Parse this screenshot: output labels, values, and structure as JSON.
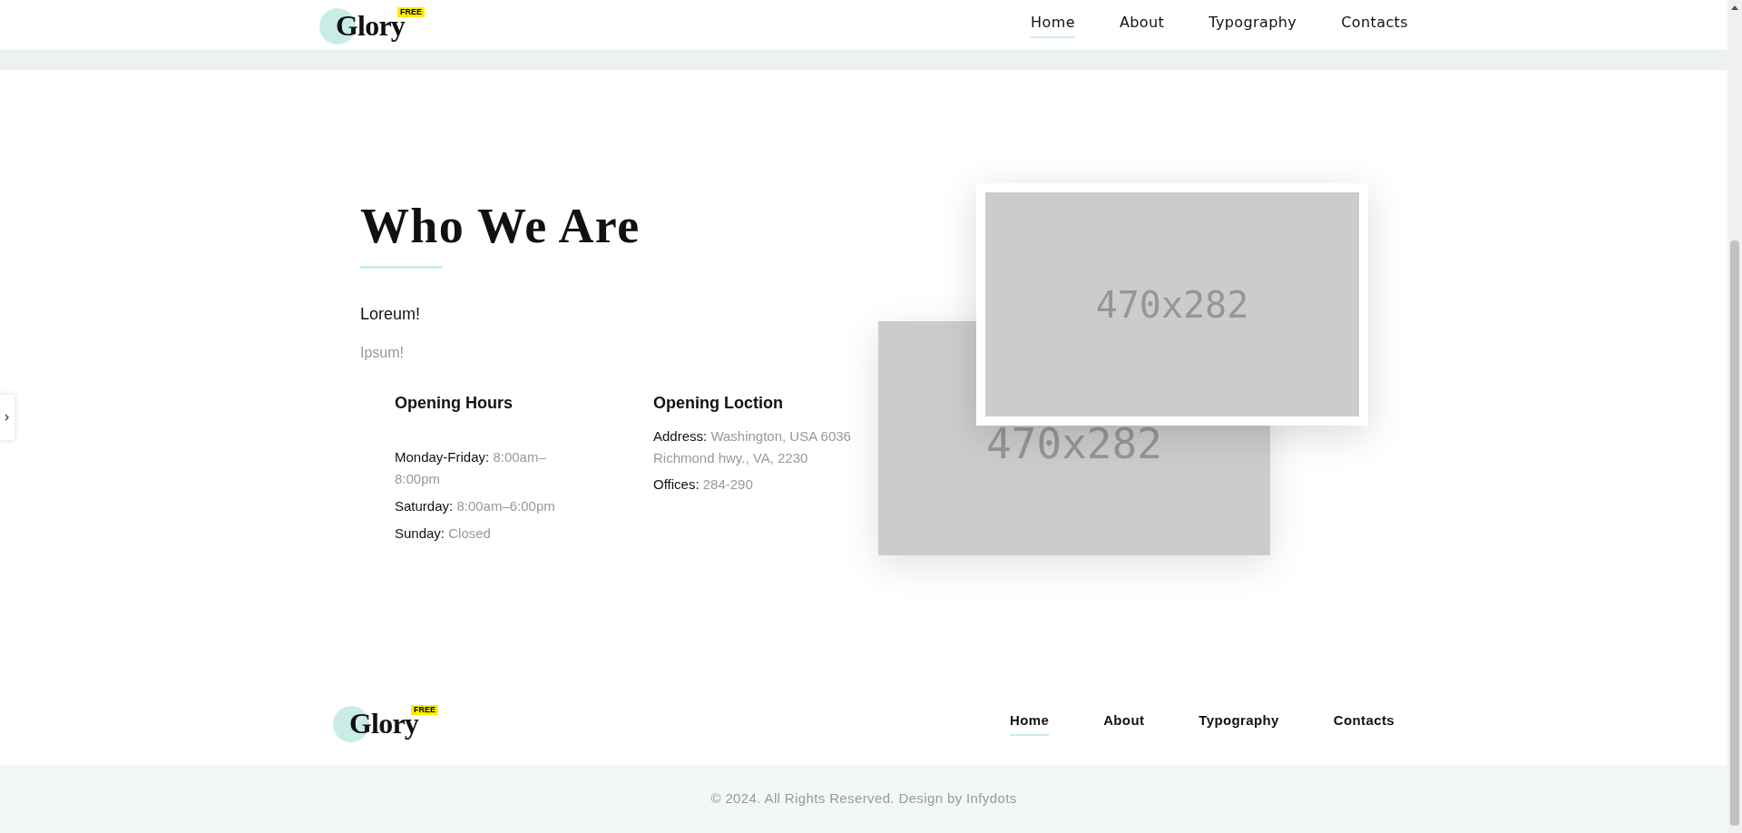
{
  "header": {
    "logo": {
      "text": "Glory",
      "badge": "FREE"
    },
    "nav": [
      {
        "label": "Home",
        "selected": true
      },
      {
        "label": "About",
        "selected": false
      },
      {
        "label": "Typography",
        "selected": false
      },
      {
        "label": "Contacts",
        "selected": false
      }
    ]
  },
  "about": {
    "title": "Who We Are",
    "lead": "Loreum!",
    "subtext": "Ipsum!",
    "hours": {
      "title": "Opening Hours",
      "items": [
        {
          "label": "Monday-Friday:",
          "value": "8:00am–8:00pm"
        },
        {
          "label": "Saturday:",
          "value": "8:00am–6:00pm"
        },
        {
          "label": "Sunday:",
          "value": "Closed"
        }
      ]
    },
    "location": {
      "title": "Opening Loction",
      "items": [
        {
          "label": "Address:",
          "value": "Washington, USA 6036 Richmond hwy., VA, 2230"
        },
        {
          "label": "Offices:",
          "value": "284-290"
        }
      ]
    },
    "images": [
      {
        "label": "470x282"
      },
      {
        "label": "470x282"
      }
    ]
  },
  "footer": {
    "logo": {
      "text": "Glory",
      "badge": "FREE"
    },
    "nav": [
      {
        "label": "Home",
        "selected": true
      },
      {
        "label": "About",
        "selected": false
      },
      {
        "label": "Typography",
        "selected": false
      },
      {
        "label": "Contacts",
        "selected": false
      }
    ],
    "copyright": "© 2024. All Rights Reserved. Design by Infydots"
  }
}
